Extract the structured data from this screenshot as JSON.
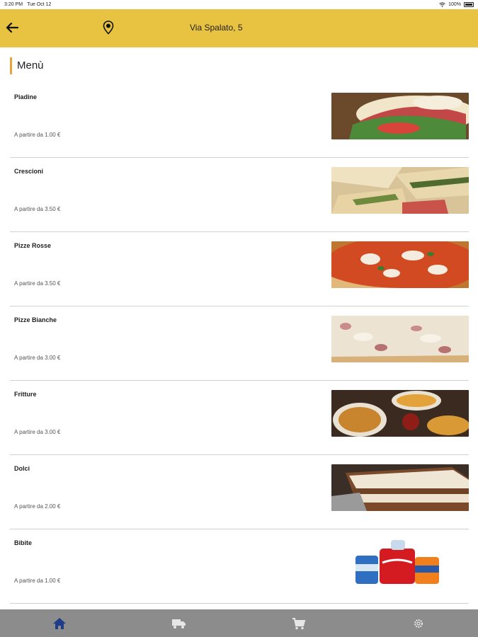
{
  "status_bar": {
    "time": "3:20 PM",
    "date": "Tue Oct 12",
    "battery": "100%"
  },
  "header": {
    "address": "Via Spalato, 5",
    "back_icon": "arrow-left-icon",
    "location_icon": "map-pin-icon",
    "background_color": "#e8c241"
  },
  "menu": {
    "title": "Menù",
    "accent_color": "#e8a33c",
    "items": [
      {
        "name": "Piadine",
        "price": "A partire da 1.00 €"
      },
      {
        "name": "Crescioni",
        "price": "A partire da 3.50 €"
      },
      {
        "name": "Pizze Rosse",
        "price": "A partire da 3.50 €"
      },
      {
        "name": "Pizze Bianche",
        "price": "A partire da 3.00 €"
      },
      {
        "name": "Fritture",
        "price": "A partire da 3.00 €"
      },
      {
        "name": "Dolci",
        "price": "A partire da 2.00 €"
      },
      {
        "name": "Bibite",
        "price": "A partire da 1.00 €"
      }
    ]
  },
  "tab_bar": {
    "background_color": "#8c8c8c",
    "active_color": "#1f3c88",
    "tabs": [
      {
        "icon": "home-icon",
        "active": true
      },
      {
        "icon": "delivery-truck-icon",
        "active": false
      },
      {
        "icon": "shopping-cart-icon",
        "active": false
      },
      {
        "icon": "gear-icon",
        "active": false
      }
    ]
  }
}
